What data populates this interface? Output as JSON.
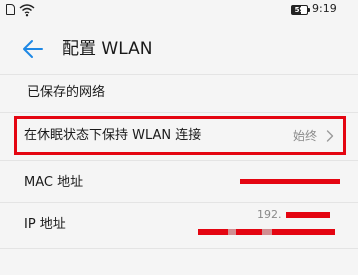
{
  "status_bar": {
    "battery_level": "59",
    "battery_fraction": 0.59,
    "time": "9:19"
  },
  "header": {
    "title": "配置 WLAN",
    "back_icon": "arrow-left-icon"
  },
  "main": {
    "saved_networks_label": "已保存的网络",
    "keep_wlan_row": {
      "label": "在休眠状态下保持 WLAN 连接",
      "value": "始终"
    },
    "mac_row": {
      "label": "MAC 地址"
    },
    "ip_row": {
      "label": "IP 地址",
      "value_visible_prefix": "192."
    }
  },
  "colors": {
    "highlight_red": "#e40511",
    "accent_blue": "#1e88e5",
    "secondary_text": "#8a8a8a",
    "background": "#f5f5f5"
  }
}
